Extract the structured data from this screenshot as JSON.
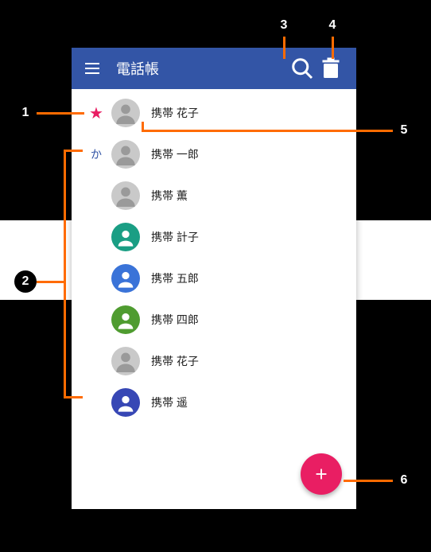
{
  "appbar": {
    "title": "電話帳"
  },
  "sections": [
    {
      "index_type": "star",
      "index_label": "★",
      "contacts": [
        {
          "name": "携帯 花子",
          "avatar_color": "gray",
          "avatar_type": "silhouette"
        }
      ]
    },
    {
      "index_type": "text",
      "index_label": "か",
      "contacts": [
        {
          "name": "携帯 一郎",
          "avatar_color": "gray",
          "avatar_type": "silhouette"
        },
        {
          "name": "携帯 薫",
          "avatar_color": "gray",
          "avatar_type": "silhouette"
        },
        {
          "name": "携帯 計子",
          "avatar_color": "teal",
          "avatar_type": "person"
        },
        {
          "name": "携帯 五郎",
          "avatar_color": "blue",
          "avatar_type": "person"
        },
        {
          "name": "携帯 四郎",
          "avatar_color": "green",
          "avatar_type": "person"
        },
        {
          "name": "携帯 花子",
          "avatar_color": "gray",
          "avatar_type": "silhouette"
        },
        {
          "name": "携帯 遥",
          "avatar_color": "indigo",
          "avatar_type": "person"
        }
      ]
    }
  ],
  "callouts": {
    "1": "1",
    "2": "2",
    "3": "3",
    "4": "4",
    "5": "5",
    "6": "6"
  }
}
